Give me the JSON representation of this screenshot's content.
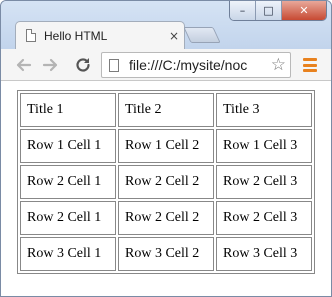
{
  "window": {
    "controls": {
      "minimize": "–",
      "maximize": "□",
      "close": "✕"
    }
  },
  "tab": {
    "title": "Hello HTML",
    "close": "×"
  },
  "toolbar": {
    "address": "file:///C:/mysite/noc",
    "back_icon": "back-arrow-icon",
    "forward_icon": "forward-arrow-icon",
    "reload_icon": "reload-icon",
    "bookmark_icon": "star-icon",
    "menu_icon": "hamburger-menu-icon"
  },
  "table": {
    "header": [
      "Title 1",
      "Title 2",
      "Title 3"
    ],
    "rows": [
      [
        "Row 1 Cell 1",
        "Row 1 Cell 2",
        "Row 1 Cell 3"
      ],
      [
        "Row 2 Cell 1",
        "Row 2 Cell 2",
        "Row 2 Cell 3"
      ],
      [
        "Row 2 Cell 1",
        "Row 2 Cell 2",
        "Row 2 Cell 3"
      ],
      [
        "Row 3 Cell 1",
        "Row 3 Cell 2",
        "Row 3 Cell 3"
      ]
    ]
  },
  "colors": {
    "menu_accent": "#e8821f",
    "window_frame": "#c7d7ee",
    "close_button": "#c74a33"
  }
}
